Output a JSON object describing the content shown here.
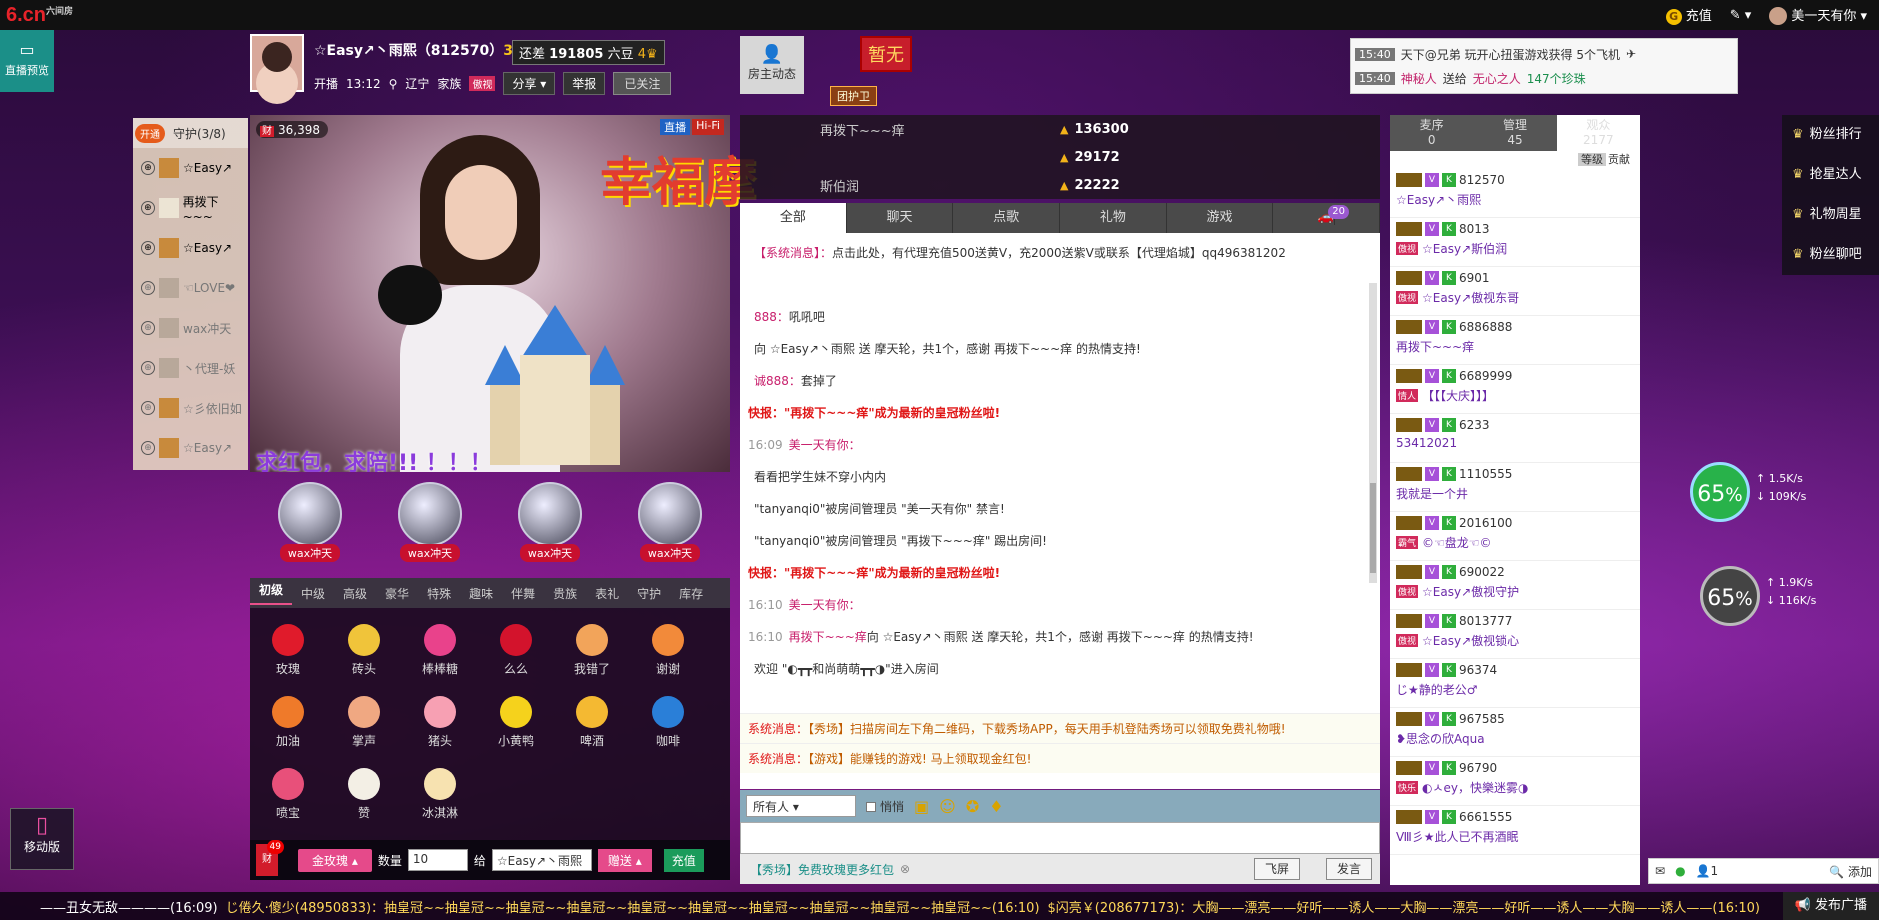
{
  "topbar": {
    "logo": "6.cn",
    "logo_sub": "六间房",
    "recharge": "充值",
    "edit_icon": "edit-icon",
    "user_name": "美一天有你"
  },
  "preview_tab": {
    "label": "直播预览"
  },
  "anchor": {
    "name": "☆Easy↗丶雨熙（812570）",
    "level": "3",
    "beans_text": "还差",
    "beans_value": "191805",
    "beans_unit": "六豆",
    "beans_level": "4",
    "start_label": "开播",
    "start_time": "13:12",
    "location": "辽宁",
    "family_label": "家族",
    "family_tag": "傲视",
    "share": "分享",
    "report": "举报",
    "followed": "已关注"
  },
  "host_dynamic": "房主动态",
  "zanwu": "暂无",
  "guard_tag": "团护卫",
  "board": [
    {
      "time": "15:40",
      "text": "天下@兄弟 玩开心扭蛋游戏获得 5个飞机"
    },
    {
      "time": "15:40",
      "text_a": "神秘人",
      "text_b": "送给",
      "text_c": "无心之人",
      "text_d": "147个珍珠"
    }
  ],
  "guard_panel": {
    "open": "开通",
    "title": "守护(3/8)",
    "items": [
      "☆Easy↗",
      "再拨下~~~",
      "☆Easy↗",
      "☜LOVE❤",
      "wax冲天",
      "丶代理-妖",
      "☆彡依旧如",
      "☆Easy↗"
    ]
  },
  "video": {
    "wealth": "36,398",
    "wealth_tag": "财",
    "live": "直播",
    "hifi": "Hi-Fi",
    "caption": "求红包，求陪!!!   ！！！",
    "overlay": "幸福摩"
  },
  "globes": [
    "wax冲天",
    "wax冲天",
    "wax冲天",
    "wax冲天"
  ],
  "gift_tabs": [
    "初级",
    "中级",
    "高级",
    "豪华",
    "特殊",
    "趣味",
    "伴舞",
    "贵族",
    "表礼",
    "守护",
    "库存"
  ],
  "gifts": [
    {
      "name": "玫瑰",
      "color": "#e01b2b"
    },
    {
      "name": "砖头",
      "color": "#f0c43a"
    },
    {
      "name": "棒棒糖",
      "color": "#e9428b"
    },
    {
      "name": "么么",
      "color": "#d3132c"
    },
    {
      "name": "我错了",
      "color": "#f2a45a"
    },
    {
      "name": "谢谢",
      "color": "#f28a3a"
    },
    {
      "name": "加油",
      "color": "#ef7a2a"
    },
    {
      "name": "掌声",
      "color": "#f0a882"
    },
    {
      "name": "猪头",
      "color": "#f7a0b3"
    },
    {
      "name": "小黄鸭",
      "color": "#f5d21c"
    },
    {
      "name": "啤酒",
      "color": "#f4b932"
    },
    {
      "name": "咖啡",
      "color": "#2a7fd8"
    },
    {
      "name": "喷宝",
      "color": "#e8507a"
    },
    {
      "name": "赞",
      "color": "#f3efe5"
    },
    {
      "name": "冰淇淋",
      "color": "#f7e2b0"
    }
  ],
  "gift_bar": {
    "cai": "财",
    "cai_count": "49",
    "selected_gift": "金玫瑰",
    "qty_label": "数量",
    "qty_value": "10",
    "to_label": "给",
    "to_value": "☆Easy↗丶雨熙",
    "send": "赠送",
    "recharge": "充值"
  },
  "rank": [
    {
      "name": "再拨下~~~痒",
      "value": "136300"
    },
    {
      "name": "",
      "value": "29172"
    },
    {
      "name": "斯伯润",
      "value": "22222"
    }
  ],
  "chat": {
    "tabs": [
      "全部",
      "聊天",
      "点歌",
      "礼物",
      "游戏",
      ""
    ],
    "car_count": "20",
    "messages": [
      {
        "t": "",
        "u": "【系统消息】：",
        "text": "点击此处，有代理充值500送黄V，充2000送紫V或联系【代理焰城】qq496381202"
      },
      {
        "t": "",
        "u": "",
        "text": ""
      },
      {
        "t": "",
        "u": "888：",
        "text": "吼吼吧"
      },
      {
        "t": "",
        "u": "",
        "text": "向 ☆Easy↗丶雨熙 送 摩天轮，共1个，感谢 再拨下~~~痒 的热情支持!"
      },
      {
        "t": "",
        "u": "诚888：",
        "text": "套掉了"
      },
      {
        "t": "",
        "red": "快报：\"再拨下~~~痒\"成为最新的皇冠粉丝啦!"
      },
      {
        "t": "16:09",
        "u": "美一天有你：",
        "text": ""
      },
      {
        "t": "",
        "u": "",
        "text": "看看把学生妹不穿小内内"
      },
      {
        "t": "",
        "u": "",
        "text": "\"tanyanqi0\"被房间管理员 \"美一天有你\" 禁言!"
      },
      {
        "t": "",
        "u": "",
        "text": "\"tanyanqi0\"被房间管理员 \"再拨下~~~痒\" 踢出房间!"
      },
      {
        "t": "",
        "red": "快报：\"再拨下~~~痒\"成为最新的皇冠粉丝啦!"
      },
      {
        "t": "16:10",
        "u": "美一天有你：",
        "text": ""
      },
      {
        "t": "16:10",
        "u": "再拨下~~~痒",
        "text": "向 ☆Easy↗丶雨熙 送 摩天轮，共1个，感谢 再拨下~~~痒 的热情支持!"
      },
      {
        "t": "",
        "u": "",
        "text": "欢迎 \"◐┳┳和尚萌萌┳┳◑\"进入房间"
      }
    ],
    "sys1_label": "系统消息：",
    "sys1": "【秀场】扫描房间左下角二维码，下载秀场APP，每天用手机登陆秀场可以领取免费礼物哦!",
    "sys2_label": "系统消息：",
    "sys2": "【游戏】能赚钱的游戏! 马上领取现金红包!",
    "target": "所有人",
    "whisper": "悄悄",
    "footer_link": "【秀场】免费玫瑰更多红包",
    "fly": "飞屏",
    "say": "发言"
  },
  "user_list": {
    "tabs": [
      {
        "label": "麦序",
        "count": "0"
      },
      {
        "label": "管理",
        "count": "45"
      },
      {
        "label": "观众",
        "count": "2177"
      }
    ],
    "sub_a": "等级",
    "sub_b": "贡献",
    "users": [
      {
        "id": "812570",
        "tag": "",
        "name": "☆Easy↗丶雨熙"
      },
      {
        "id": "8013",
        "tag": "傲视",
        "name": "☆Easy↗斯伯润"
      },
      {
        "id": "6901",
        "tag": "傲视",
        "name": "☆Easy↗傲视东哥"
      },
      {
        "id": "6886888",
        "tag": "",
        "name": "再拨下~~~痒"
      },
      {
        "id": "6689999",
        "tag": "情人",
        "name": "【【【大庆】】】"
      },
      {
        "id": "6233",
        "tag": "",
        "name": "53412021"
      },
      {
        "id": "1110555",
        "tag": "",
        "name": "我就是一个井"
      },
      {
        "id": "2016100",
        "tag": "霸气",
        "name": "©☜盘龙☜©"
      },
      {
        "id": "690022",
        "tag": "傲视",
        "name": "☆Easy↗傲视守护"
      },
      {
        "id": "8013777",
        "tag": "傲视",
        "name": "☆Easy↗傲视锁心"
      },
      {
        "id": "96374",
        "tag": "",
        "name": "じ★静的老公♂"
      },
      {
        "id": "967585",
        "tag": "",
        "name": "❥思念の欣Aqua"
      },
      {
        "id": "96790",
        "tag": "快乐",
        "name": "◐ㅅey，快樂迷雾◑"
      },
      {
        "id": "6661555",
        "tag": "",
        "name": "Ⅷ彡★此人已不再酒眠"
      }
    ]
  },
  "right_side": [
    "粉丝排行",
    "抢星达人",
    "礼物周星",
    "粉丝聊吧"
  ],
  "speed1": {
    "pct": "65",
    "up": "1.5K/s",
    "down": "109K/s"
  },
  "speed2": {
    "pct": "65",
    "up": "1.9K/s",
    "down": "116K/s"
  },
  "mobile": "移动版",
  "dock": {
    "count": "1",
    "add": "添加"
  },
  "ticker": {
    "a": "——丑女无敌————(16:09)",
    "b": "じ倦久·傻少(48950833)：抽皇冠~~抽皇冠~~抽皇冠~~抽皇冠~~抽皇冠~~抽皇冠~~抽皇冠~~抽皇冠~~抽皇冠~~抽皇冠~~(16:10)",
    "c": "$闪亮￥(208677173)：大胸——漂亮——好听——诱人——大胸——漂亮——好听——诱人——大胸——诱人——(16:10)",
    "publish": "发布广播"
  },
  "colors": {
    "accent": "#e54a8a",
    "teal": "#1b8f88",
    "gold": "#f2b21a"
  }
}
